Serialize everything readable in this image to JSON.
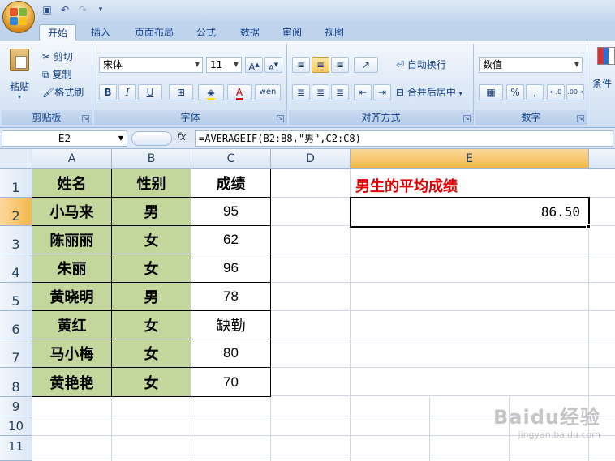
{
  "quick_access": {
    "save_icon": "save-icon",
    "undo_icon": "undo-icon",
    "redo_icon": "redo-icon"
  },
  "tabs": [
    {
      "label": "开始",
      "active": true
    },
    {
      "label": "插入"
    },
    {
      "label": "页面布局"
    },
    {
      "label": "公式"
    },
    {
      "label": "数据"
    },
    {
      "label": "审阅"
    },
    {
      "label": "视图"
    }
  ],
  "ribbon": {
    "clipboard": {
      "paste": "粘贴",
      "cut": "剪切",
      "copy": "复制",
      "format_painter": "格式刷",
      "label": "剪贴板"
    },
    "font": {
      "name": "宋体",
      "size": "11",
      "bold": "B",
      "italic": "I",
      "underline": "U",
      "grow": "A",
      "shrink": "A",
      "color": "A",
      "phonetic": "wén",
      "label": "字体"
    },
    "alignment": {
      "wrap": "自动换行",
      "merge": "合并后居中",
      "label": "对齐方式"
    },
    "number": {
      "format": "数值",
      "percent": "%",
      "comma": ",",
      "label": "数字"
    },
    "styles": {
      "conditional": "条件"
    }
  },
  "formula_bar": {
    "name_box": "E2",
    "fx": "fx",
    "formula": "=AVERAGEIF(B2:B8,\"男\",C2:C8)"
  },
  "columns": [
    "A",
    "B",
    "C",
    "D",
    "E"
  ],
  "rows": [
    "1",
    "2",
    "3",
    "4",
    "5",
    "6",
    "7",
    "8",
    "9",
    "10",
    "11"
  ],
  "table": {
    "headers": [
      "姓名",
      "性别",
      "成绩"
    ],
    "rows": [
      [
        "小马来",
        "男",
        "95"
      ],
      [
        "陈丽丽",
        "女",
        "62"
      ],
      [
        "朱丽",
        "女",
        "96"
      ],
      [
        "黄晓明",
        "男",
        "78"
      ],
      [
        "黄红",
        "女",
        "缺勤"
      ],
      [
        "马小梅",
        "女",
        "80"
      ],
      [
        "黄艳艳",
        "女",
        "70"
      ]
    ]
  },
  "result": {
    "title": "男生的平均成绩",
    "value": "86.50"
  },
  "watermark": {
    "brand": "Baidu经验",
    "url": "jingyan.baidu.com"
  },
  "colors": {
    "accent_red": "#e00000",
    "header_green": "#c3d69b",
    "selected_header": "#f4b84a"
  }
}
